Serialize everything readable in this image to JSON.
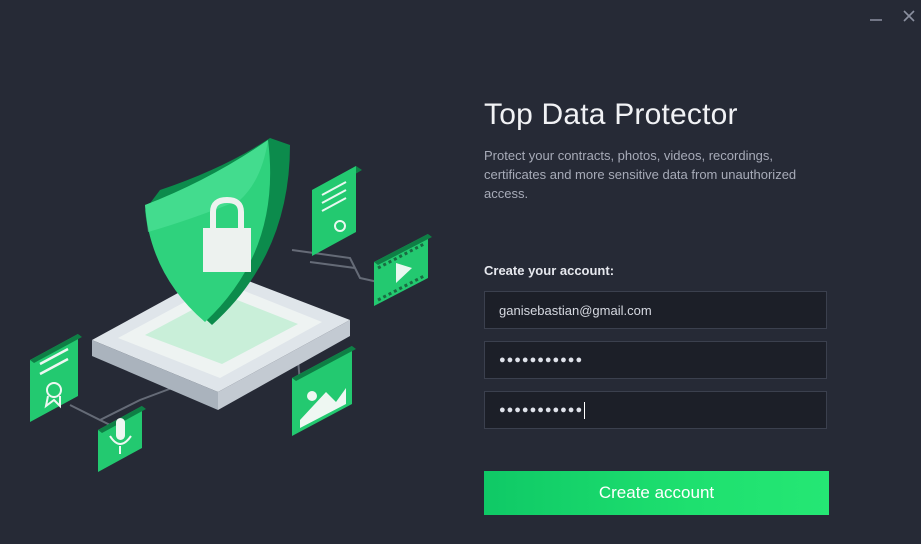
{
  "window": {
    "minimize_icon": "minimize-icon",
    "close_icon": "close-icon"
  },
  "hero": {
    "title": "Top Data Protector",
    "description": "Protect your contracts, photos, videos, recordings, certificates and more sensitive data from unauthorized access."
  },
  "form": {
    "label": "Create your account:",
    "email_value": "ganisebastian@gmail.com",
    "password_mask": "●●●●●●●●●●●",
    "confirm_password_mask": "●●●●●●●●●●●",
    "submit_label": "Create account"
  },
  "illustration": {
    "icons": [
      "shield-lock-icon",
      "document-icon",
      "video-icon",
      "image-icon",
      "microphone-icon",
      "certificate-icon"
    ]
  },
  "colors": {
    "background": "#262a36",
    "accent": "#1ee06f",
    "input_background": "#1c1f28",
    "input_border": "#3b404e"
  }
}
